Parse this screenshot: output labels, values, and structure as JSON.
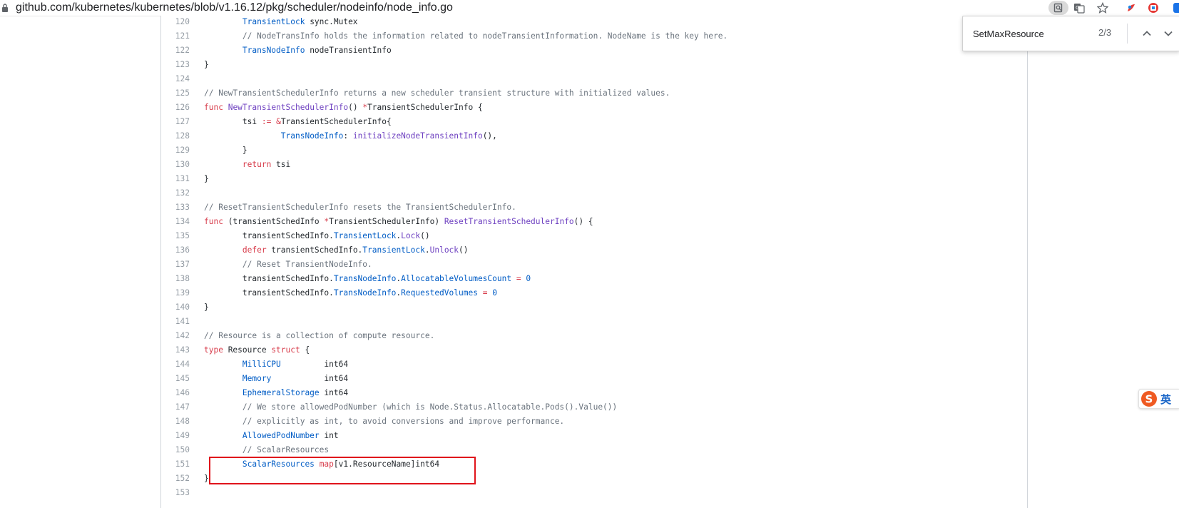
{
  "browser": {
    "url": "github.com/kubernetes/kubernetes/blob/v1.16.12/pkg/scheduler/nodeinfo/node_info.go",
    "icons": [
      "lock-icon",
      "zoom-icon",
      "translate-icon",
      "star-icon",
      "extension-icon",
      "extension-icon",
      "extension-icon"
    ]
  },
  "find_bar": {
    "query": "SetMaxResource",
    "count": "2/3"
  },
  "ime": {
    "mode": "英"
  },
  "code": {
    "lines": [
      {
        "n": "120",
        "t": [
          {
            "c": "",
            "s": "        "
          },
          {
            "c": "nm",
            "s": "TransientLock"
          },
          {
            "c": "",
            "s": " sync.Mutex"
          }
        ]
      },
      {
        "n": "121",
        "t": [
          {
            "c": "",
            "s": "        "
          },
          {
            "c": "cm",
            "s": "// NodeTransInfo holds the information related to nodeTransientInformation. NodeName is the key here."
          }
        ]
      },
      {
        "n": "122",
        "t": [
          {
            "c": "",
            "s": "        "
          },
          {
            "c": "nm",
            "s": "TransNodeInfo"
          },
          {
            "c": "",
            "s": " nodeTransientInfo"
          }
        ]
      },
      {
        "n": "123",
        "t": [
          {
            "c": "",
            "s": "}"
          }
        ]
      },
      {
        "n": "124",
        "t": []
      },
      {
        "n": "125",
        "t": [
          {
            "c": "cm",
            "s": "// NewTransientSchedulerInfo returns a new scheduler transient structure with initialized values."
          }
        ]
      },
      {
        "n": "126",
        "t": [
          {
            "c": "kw",
            "s": "func"
          },
          {
            "c": "",
            "s": " "
          },
          {
            "c": "fn",
            "s": "NewTransientSchedulerInfo"
          },
          {
            "c": "",
            "s": "() "
          },
          {
            "c": "kw",
            "s": "*"
          },
          {
            "c": "",
            "s": "TransientSchedulerInfo {"
          }
        ]
      },
      {
        "n": "127",
        "t": [
          {
            "c": "",
            "s": "        tsi "
          },
          {
            "c": "kw",
            "s": ":="
          },
          {
            "c": "",
            "s": " "
          },
          {
            "c": "kw",
            "s": "&"
          },
          {
            "c": "",
            "s": "TransientSchedulerInfo{"
          }
        ]
      },
      {
        "n": "128",
        "t": [
          {
            "c": "",
            "s": "                "
          },
          {
            "c": "nm",
            "s": "TransNodeInfo"
          },
          {
            "c": "",
            "s": ": "
          },
          {
            "c": "fn",
            "s": "initializeNodeTransientInfo"
          },
          {
            "c": "",
            "s": "(),"
          }
        ]
      },
      {
        "n": "129",
        "t": [
          {
            "c": "",
            "s": "        }"
          }
        ]
      },
      {
        "n": "130",
        "t": [
          {
            "c": "",
            "s": "        "
          },
          {
            "c": "kw",
            "s": "return"
          },
          {
            "c": "",
            "s": " tsi"
          }
        ]
      },
      {
        "n": "131",
        "t": [
          {
            "c": "",
            "s": "}"
          }
        ]
      },
      {
        "n": "132",
        "t": []
      },
      {
        "n": "133",
        "t": [
          {
            "c": "cm",
            "s": "// ResetTransientSchedulerInfo resets the TransientSchedulerInfo."
          }
        ]
      },
      {
        "n": "134",
        "t": [
          {
            "c": "kw",
            "s": "func"
          },
          {
            "c": "",
            "s": " (transientSchedInfo "
          },
          {
            "c": "kw",
            "s": "*"
          },
          {
            "c": "",
            "s": "TransientSchedulerInfo) "
          },
          {
            "c": "fn",
            "s": "ResetTransientSchedulerInfo"
          },
          {
            "c": "",
            "s": "() {"
          }
        ]
      },
      {
        "n": "135",
        "t": [
          {
            "c": "",
            "s": "        transientSchedInfo."
          },
          {
            "c": "nm",
            "s": "TransientLock"
          },
          {
            "c": "",
            "s": "."
          },
          {
            "c": "fn",
            "s": "Lock"
          },
          {
            "c": "",
            "s": "()"
          }
        ]
      },
      {
        "n": "136",
        "t": [
          {
            "c": "",
            "s": "        "
          },
          {
            "c": "kw",
            "s": "defer"
          },
          {
            "c": "",
            "s": " transientSchedInfo."
          },
          {
            "c": "nm",
            "s": "TransientLock"
          },
          {
            "c": "",
            "s": "."
          },
          {
            "c": "fn",
            "s": "Unlock"
          },
          {
            "c": "",
            "s": "()"
          }
        ]
      },
      {
        "n": "137",
        "t": [
          {
            "c": "",
            "s": "        "
          },
          {
            "c": "cm",
            "s": "// Reset TransientNodeInfo."
          }
        ]
      },
      {
        "n": "138",
        "t": [
          {
            "c": "",
            "s": "        transientSchedInfo."
          },
          {
            "c": "nm",
            "s": "TransNodeInfo"
          },
          {
            "c": "",
            "s": "."
          },
          {
            "c": "nm",
            "s": "AllocatableVolumesCount"
          },
          {
            "c": "",
            "s": " "
          },
          {
            "c": "kw",
            "s": "="
          },
          {
            "c": "",
            "s": " "
          },
          {
            "c": "nm",
            "s": "0"
          }
        ]
      },
      {
        "n": "139",
        "t": [
          {
            "c": "",
            "s": "        transientSchedInfo."
          },
          {
            "c": "nm",
            "s": "TransNodeInfo"
          },
          {
            "c": "",
            "s": "."
          },
          {
            "c": "nm",
            "s": "RequestedVolumes"
          },
          {
            "c": "",
            "s": " "
          },
          {
            "c": "kw",
            "s": "="
          },
          {
            "c": "",
            "s": " "
          },
          {
            "c": "nm",
            "s": "0"
          }
        ]
      },
      {
        "n": "140",
        "t": [
          {
            "c": "",
            "s": "}"
          }
        ]
      },
      {
        "n": "141",
        "t": []
      },
      {
        "n": "142",
        "t": [
          {
            "c": "cm",
            "s": "// Resource is a collection of compute resource."
          }
        ]
      },
      {
        "n": "143",
        "t": [
          {
            "c": "kw",
            "s": "type"
          },
          {
            "c": "",
            "s": " Resource "
          },
          {
            "c": "kw",
            "s": "struct"
          },
          {
            "c": "",
            "s": " {"
          }
        ]
      },
      {
        "n": "144",
        "t": [
          {
            "c": "",
            "s": "        "
          },
          {
            "c": "nm",
            "s": "MilliCPU"
          },
          {
            "c": "",
            "s": "         int64"
          }
        ]
      },
      {
        "n": "145",
        "t": [
          {
            "c": "",
            "s": "        "
          },
          {
            "c": "nm",
            "s": "Memory"
          },
          {
            "c": "",
            "s": "           int64"
          }
        ]
      },
      {
        "n": "146",
        "t": [
          {
            "c": "",
            "s": "        "
          },
          {
            "c": "nm",
            "s": "EphemeralStorage"
          },
          {
            "c": "",
            "s": " int64"
          }
        ]
      },
      {
        "n": "147",
        "t": [
          {
            "c": "",
            "s": "        "
          },
          {
            "c": "cm",
            "s": "// We store allowedPodNumber (which is Node.Status.Allocatable.Pods().Value())"
          }
        ]
      },
      {
        "n": "148",
        "t": [
          {
            "c": "",
            "s": "        "
          },
          {
            "c": "cm",
            "s": "// explicitly as int, to avoid conversions and improve performance."
          }
        ]
      },
      {
        "n": "149",
        "t": [
          {
            "c": "",
            "s": "        "
          },
          {
            "c": "nm",
            "s": "AllowedPodNumber"
          },
          {
            "c": "",
            "s": " int"
          }
        ]
      },
      {
        "n": "150",
        "t": [
          {
            "c": "",
            "s": "        "
          },
          {
            "c": "cm",
            "s": "// ScalarResources"
          }
        ]
      },
      {
        "n": "151",
        "t": [
          {
            "c": "",
            "s": "        "
          },
          {
            "c": "nm",
            "s": "ScalarResources"
          },
          {
            "c": "",
            "s": " "
          },
          {
            "c": "kw",
            "s": "map"
          },
          {
            "c": "",
            "s": "[v1.ResourceName]int64"
          }
        ]
      },
      {
        "n": "152",
        "t": [
          {
            "c": "",
            "s": "}"
          }
        ]
      },
      {
        "n": "153",
        "t": []
      }
    ]
  },
  "colors": {
    "keyword": "#d73a49",
    "name": "#005cc5",
    "function": "#6f42c1",
    "comment": "#6a737d",
    "highlight_box": "#e0131b"
  }
}
